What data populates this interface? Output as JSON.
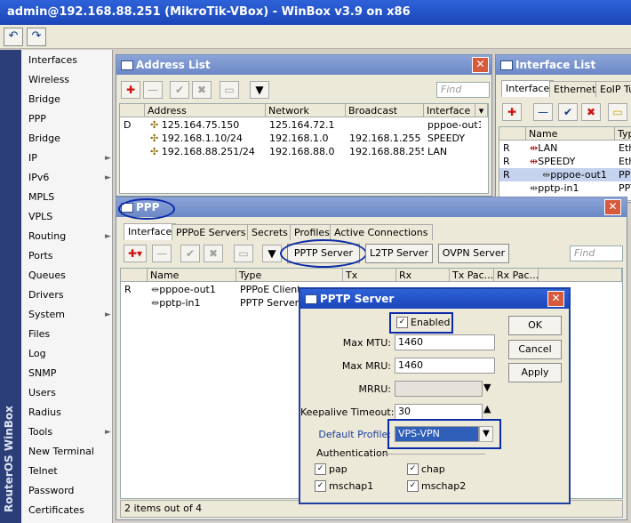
{
  "app": {
    "title": "admin@192.168.88.251 (MikroTik-VBox) - WinBox v3.9 on x86",
    "toolbar": {
      "undo_icon": "undo-icon",
      "redo_icon": "redo-icon"
    },
    "brand_vertical": "RouterOS WinBox"
  },
  "menu": {
    "items": [
      {
        "label": "Interfaces",
        "sub": false
      },
      {
        "label": "Wireless",
        "sub": false
      },
      {
        "label": "Bridge",
        "sub": false
      },
      {
        "label": "PPP",
        "sub": false
      },
      {
        "label": "Bridge",
        "sub": false
      },
      {
        "label": "IP",
        "sub": true
      },
      {
        "label": "IPv6",
        "sub": true
      },
      {
        "label": "MPLS",
        "sub": false
      },
      {
        "label": "VPLS",
        "sub": false
      },
      {
        "label": "Routing",
        "sub": true
      },
      {
        "label": "Ports",
        "sub": false
      },
      {
        "label": "Queues",
        "sub": false
      },
      {
        "label": "Drivers",
        "sub": false
      },
      {
        "label": "System",
        "sub": true
      },
      {
        "label": "Files",
        "sub": false
      },
      {
        "label": "Log",
        "sub": false
      },
      {
        "label": "SNMP",
        "sub": false
      },
      {
        "label": "Users",
        "sub": false
      },
      {
        "label": "Radius",
        "sub": false
      },
      {
        "label": "Tools",
        "sub": true
      },
      {
        "label": "New Terminal",
        "sub": false
      },
      {
        "label": "Telnet",
        "sub": false
      },
      {
        "label": "Password",
        "sub": false
      },
      {
        "label": "Certificates",
        "sub": false
      }
    ],
    "submenu_arrow": "►"
  },
  "address_list": {
    "title": "Address List",
    "find_placeholder": "Find",
    "columns": [
      "Address",
      "Network",
      "Broadcast",
      "Interface"
    ],
    "rows": [
      {
        "flag": "D",
        "address": "125.164.75.150",
        "network": "125.164.72.1",
        "broadcast": "",
        "interface": "pppoe-out1"
      },
      {
        "flag": "",
        "address": "192.168.1.10/24",
        "network": "192.168.1.0",
        "broadcast": "192.168.1.255",
        "interface": "SPEEDY"
      },
      {
        "flag": "",
        "address": "192.168.88.251/24",
        "network": "192.168.88.0",
        "broadcast": "192.168.88.255",
        "interface": "LAN"
      }
    ]
  },
  "interface_list": {
    "title": "Interface List",
    "tabs": [
      "Interface",
      "Ethernet",
      "EoIP Tu"
    ],
    "columns": [
      "Name",
      "Typ"
    ],
    "rows": [
      {
        "flag": "R",
        "name": "LAN",
        "type": "Eth"
      },
      {
        "flag": "R",
        "name": "SPEEDY",
        "type": "Eth"
      },
      {
        "flag": "R",
        "name": "pppoe-out1",
        "type": "PPP"
      },
      {
        "flag": "",
        "name": "pptp-in1",
        "type": "PPT"
      }
    ]
  },
  "ppp": {
    "title": "PPP",
    "tabs": [
      "Interface",
      "PPPoE Servers",
      "Secrets",
      "Profiles",
      "Active Connections"
    ],
    "buttons": {
      "pptp_server": "PPTP Server",
      "l2tp_server": "L2TP Server",
      "ovpn_server": "OVPN Server"
    },
    "find_placeholder": "Find",
    "columns": [
      "Name",
      "Type",
      "Tx",
      "Rx",
      "Tx Pac...",
      "Rx Pac..."
    ],
    "rows": [
      {
        "flag": "R",
        "name": "pppoe-out1",
        "type": "PPPoE Client"
      },
      {
        "flag": "",
        "name": "pptp-in1",
        "type": "PPTP Server"
      }
    ],
    "status": "2 items out of 4"
  },
  "pptp_server": {
    "title": "PPTP Server",
    "enabled_label": "Enabled",
    "enabled": true,
    "max_mtu_label": "Max MTU:",
    "max_mtu": "1460",
    "max_mru_label": "Max MRU:",
    "max_mru": "1460",
    "mrru_label": "MRRU:",
    "mrru": "",
    "keepalive_label": "Keepalive Timeout:",
    "keepalive": "30",
    "default_profile_label": "Default Profile:",
    "default_profile": "VPS-VPN",
    "auth_label": "Authentication",
    "auth": [
      {
        "label": "pap",
        "checked": true
      },
      {
        "label": "chap",
        "checked": true
      },
      {
        "label": "mschap1",
        "checked": true
      },
      {
        "label": "mschap2",
        "checked": true
      }
    ],
    "buttons": {
      "ok": "OK",
      "cancel": "Cancel",
      "apply": "Apply"
    }
  },
  "glyphs": {
    "plus": "✚",
    "minus": "—",
    "check": "✔",
    "cross": "✖",
    "filter": "▼",
    "close": "✕",
    "dropdown": "▾",
    "up": "▴",
    "checkmark": "✓"
  },
  "colors": {
    "title_blue": "#1b45b8",
    "highlight": "#0b2aa8",
    "close_red": "#d65a3c",
    "profile_select": "#2f5fb8"
  }
}
